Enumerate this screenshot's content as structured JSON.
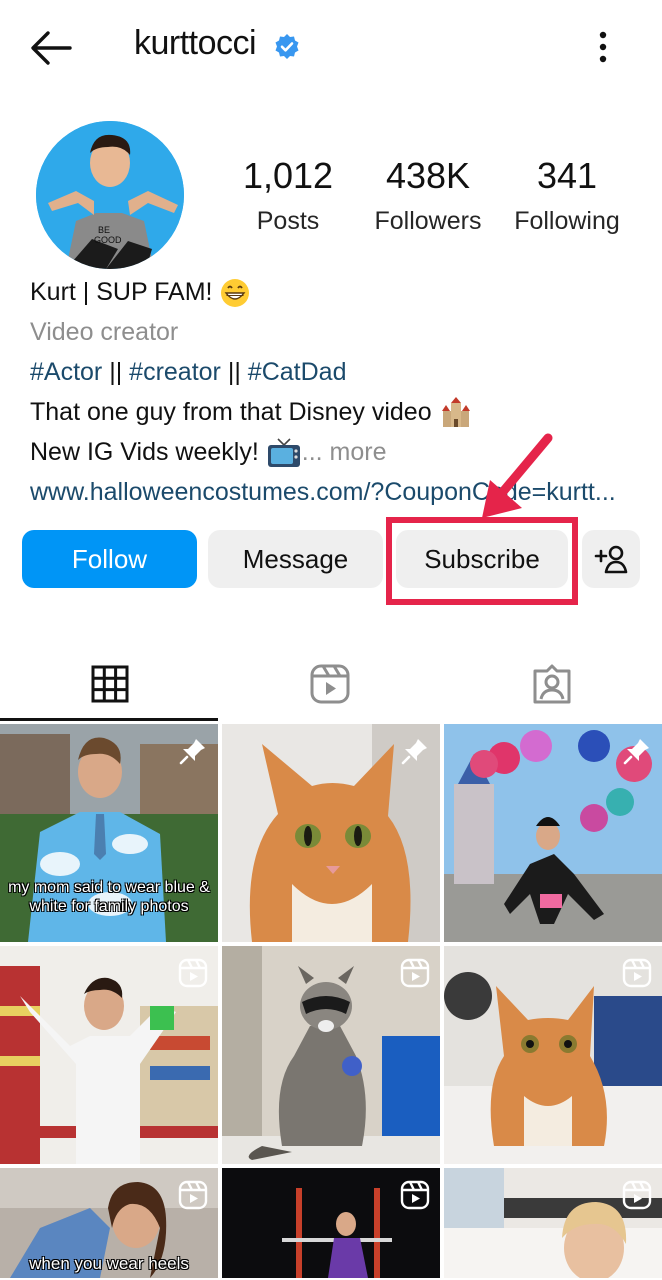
{
  "header": {
    "username": "kurttocci"
  },
  "stats": {
    "posts": {
      "value": "1,012",
      "label": "Posts"
    },
    "followers": {
      "value": "438K",
      "label": "Followers"
    },
    "following": {
      "value": "341",
      "label": "Following"
    }
  },
  "bio": {
    "name_line": "Kurt | SUP FAM!",
    "category": "Video creator",
    "hashtags": [
      "#Actor",
      "||",
      "#creator",
      "||",
      "#CatDad"
    ],
    "line3": "That one guy from that Disney video",
    "line4": "New IG Vids weekly!",
    "more": "... more",
    "link": "www.halloweencostumes.com/?CouponCode=kurtt..."
  },
  "actions": {
    "follow": "Follow",
    "message": "Message",
    "subscribe": "Subscribe"
  },
  "tabs": [
    "grid",
    "reels",
    "tagged"
  ],
  "posts": [
    {
      "type": "pinned",
      "caption": "my mom said to wear blue & white for family photos"
    },
    {
      "type": "pinned",
      "caption": ""
    },
    {
      "type": "pinned",
      "caption": ""
    },
    {
      "type": "reel",
      "caption": ""
    },
    {
      "type": "reel",
      "caption": ""
    },
    {
      "type": "reel",
      "caption": ""
    },
    {
      "type": "reel",
      "caption": "when you wear heels"
    },
    {
      "type": "reel",
      "caption": ""
    },
    {
      "type": "reel",
      "caption": ""
    }
  ],
  "colors": {
    "accent": "#0095f6",
    "highlight": "#e5244a",
    "verified": "#3897f0"
  }
}
